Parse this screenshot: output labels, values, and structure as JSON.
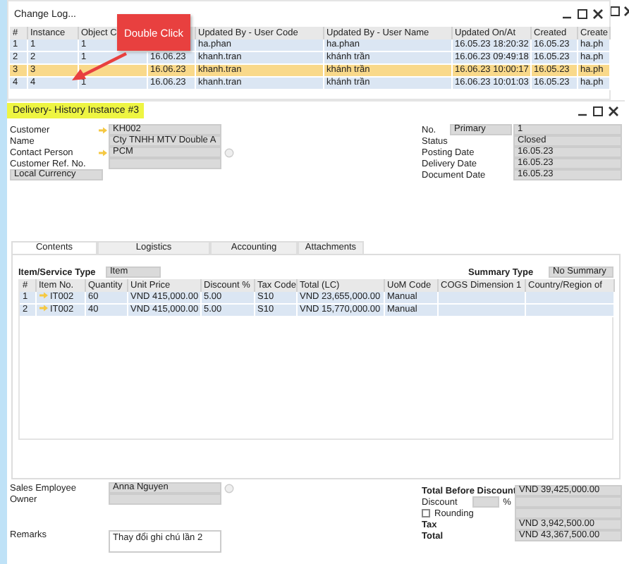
{
  "change_log": {
    "title": "Change Log...",
    "columns": [
      "#",
      "Instance",
      "Object C",
      null,
      "Updated By - User Code",
      "Updated By - User Name",
      "Updated On/At",
      "Created",
      "Create"
    ],
    "rows": [
      {
        "selected": false,
        "cells": [
          "1",
          "1",
          "1",
          null,
          "ha.phan",
          "ha.phan",
          "16.05.23 18:20:32",
          "16.05.23",
          "ha.ph"
        ]
      },
      {
        "selected": false,
        "cells": [
          "2",
          "2",
          "1",
          "16.06.23",
          "khanh.tran",
          "khánh trần",
          "16.06.23 09:49:18",
          "16.05.23",
          "ha.ph"
        ]
      },
      {
        "selected": true,
        "cells": [
          "3",
          "3",
          null,
          "16.06.23",
          "khanh.tran",
          "khánh trần",
          "16.06.23 10:00:17",
          "16.05.23",
          "ha.ph"
        ]
      },
      {
        "selected": false,
        "cells": [
          "4",
          "4",
          "1",
          "16.06.23",
          "khanh.tran",
          "khánh trần",
          "16.06.23 10:01:03",
          "16.05.23",
          "ha.ph"
        ]
      }
    ]
  },
  "callout": {
    "text": "Double Click"
  },
  "delivery": {
    "title": "Delivery- History Instance #3",
    "left_fields": [
      {
        "label": "Customer",
        "value": "KH002",
        "link": true,
        "info": false
      },
      {
        "label": "Name",
        "value": "Cty TNHH MTV Double A",
        "link": false,
        "info": false
      },
      {
        "label": "Contact Person",
        "value": "PCM",
        "link": true,
        "info": true
      },
      {
        "label": "Customer Ref. No.",
        "link": false,
        "info": false
      }
    ],
    "currency_button": "Local Currency",
    "right_fields": [
      {
        "label": "No.",
        "series": "Primary",
        "value": "1"
      },
      {
        "label": "Status",
        "value": "Closed"
      },
      {
        "label": "Posting Date",
        "value": "16.05.23"
      },
      {
        "label": "Delivery Date",
        "value": "16.05.23"
      },
      {
        "label": "Document Date",
        "value": "16.05.23"
      }
    ],
    "tabs": [
      {
        "label": "Contents",
        "selected": true
      },
      {
        "label": "Logistics",
        "selected": false
      },
      {
        "label": "Accounting",
        "selected": false
      },
      {
        "label": "Attachments",
        "selected": false
      }
    ],
    "item_type": {
      "label": "Item/Service Type",
      "value": "Item"
    },
    "summary_type": {
      "label": "Summary Type",
      "value": "No Summary"
    },
    "items": {
      "columns": [
        "#",
        "Item No.",
        "Quantity",
        "Unit Price",
        "Discount %",
        "Tax Code",
        "Total (LC)",
        "UoM Code",
        "COGS Dimension 1",
        "Country/Region of"
      ],
      "rows": [
        [
          "1",
          "IT002",
          "60",
          "VND 415,000.00",
          "5.00",
          "S10",
          "VND 23,655,000.00",
          "Manual",
          "",
          ""
        ],
        [
          "2",
          "IT002",
          "40",
          "VND 415,000.00",
          "5.00",
          "S10",
          "VND 15,770,000.00",
          "Manual",
          "",
          ""
        ]
      ]
    },
    "sales_employee": {
      "label": "Sales Employee",
      "value": "Anna Nguyen"
    },
    "owner": {
      "label": "Owner"
    },
    "remarks": {
      "label": "Remarks",
      "value": "Thay đổi ghi chú lần 2"
    },
    "totals": [
      {
        "kind": "value",
        "label": "Total Before Discount",
        "value": "VND 39,425,000.00"
      },
      {
        "kind": "discount",
        "label": "Discount",
        "unit": "%"
      },
      {
        "kind": "checkbox",
        "label": "Rounding",
        "checked": false
      },
      {
        "kind": "value",
        "label": "Tax",
        "value": "VND 3,942,500.00"
      },
      {
        "kind": "value",
        "label": "Total",
        "value": "VND 43,367,500.00"
      }
    ]
  }
}
